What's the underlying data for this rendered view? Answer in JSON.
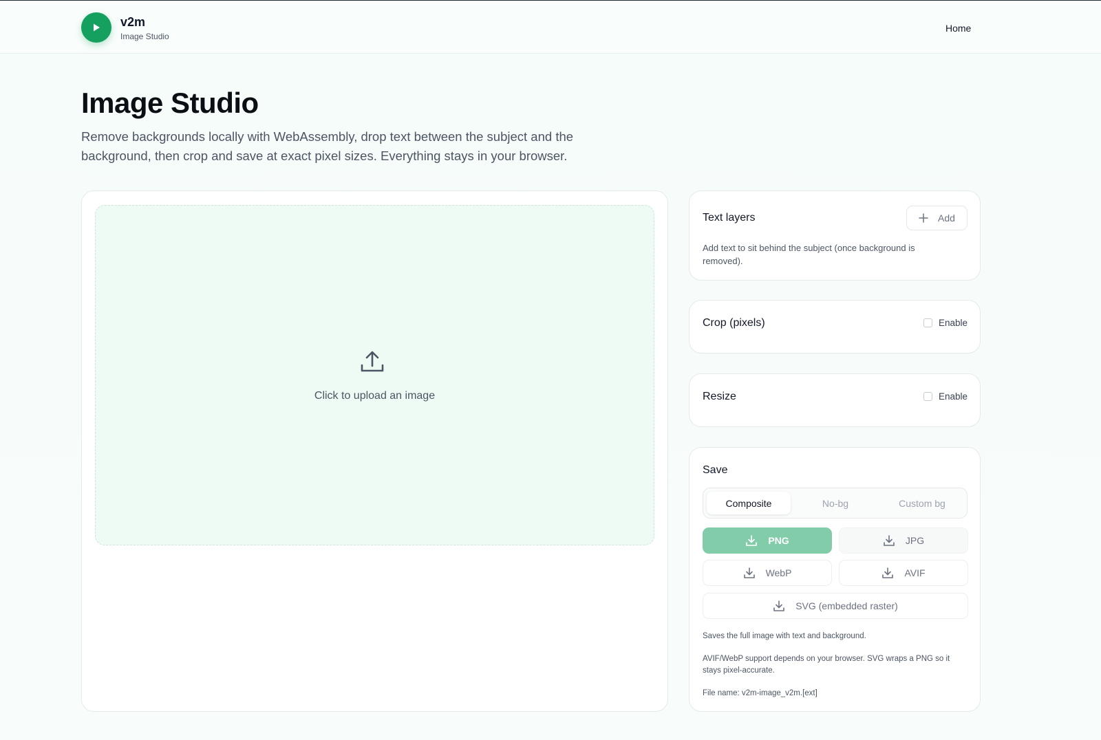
{
  "header": {
    "brand_name": "v2m",
    "brand_sub": "Image Studio",
    "nav_home": "Home"
  },
  "hero": {
    "title": "Image Studio",
    "description": "Remove backgrounds locally with WebAssembly, drop text between the subject and the background, then crop and save at exact pixel sizes. Everything stays in your browser."
  },
  "upload": {
    "label": "Click to upload an image",
    "icon": "upload-icon"
  },
  "text_layers": {
    "title": "Text layers",
    "add_label": "Add",
    "hint": "Add text to sit behind the subject (once background is removed)."
  },
  "crop": {
    "title": "Crop (pixels)",
    "enable_label": "Enable",
    "enabled": false
  },
  "resize": {
    "title": "Resize",
    "enable_label": "Enable",
    "enabled": false
  },
  "save": {
    "title": "Save",
    "modes": [
      "Composite",
      "No-bg",
      "Custom bg"
    ],
    "active_mode": "Composite",
    "formats": {
      "png": "PNG",
      "jpg": "JPG",
      "webp": "WebP",
      "avif": "AVIF",
      "svg": "SVG (embedded raster)"
    },
    "note_mode": "Saves the full image with text and background.",
    "note_support": "AVIF/WebP support depends on your browser. SVG wraps a PNG so it stays pixel-accurate.",
    "file_name": "File name: v2m-image_v2m.[ext]"
  },
  "colors": {
    "brand": "#15a05f",
    "primary_button": "#83ccaa",
    "dropzone_bg": "#eefaf4"
  }
}
